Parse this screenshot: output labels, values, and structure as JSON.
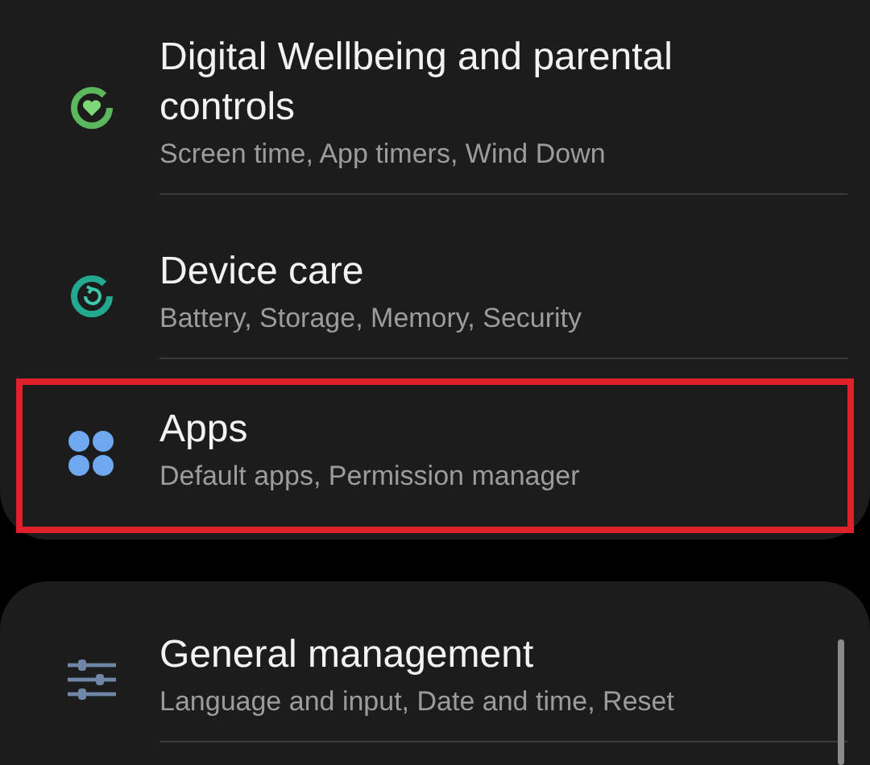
{
  "groups": [
    {
      "items": [
        {
          "kind": "wellbeing",
          "title": "Digital Wellbeing and parental controls",
          "subtitle": "Screen time, App timers, Wind Down",
          "highlighted": false
        },
        {
          "kind": "care",
          "title": "Device care",
          "subtitle": "Battery, Storage, Memory, Security",
          "highlighted": false
        },
        {
          "kind": "apps",
          "title": "Apps",
          "subtitle": "Default apps, Permission manager",
          "highlighted": true
        }
      ]
    },
    {
      "items": [
        {
          "kind": "sliders",
          "title": "General management",
          "subtitle": "Language and input, Date and time, Reset",
          "highlighted": false
        }
      ]
    }
  ]
}
